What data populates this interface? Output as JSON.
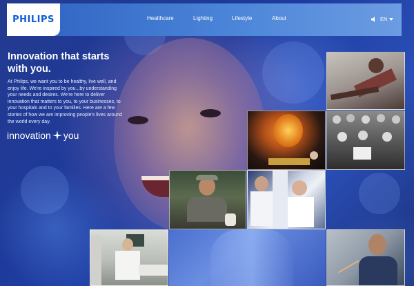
{
  "brand": {
    "logo_text": "PHILIPS"
  },
  "nav": {
    "items": [
      {
        "label": "Healthcare"
      },
      {
        "label": "Lighting"
      },
      {
        "label": "Lifestyle"
      },
      {
        "label": "About"
      }
    ],
    "language": "EN",
    "icons": [
      "speaker-icon",
      "chevron-down-icon"
    ]
  },
  "hero": {
    "headline": "Innovation that starts with you.",
    "body": "At Philips, we want you to be healthy, live well, and enjoy life. We're inspired by you...by understanding your needs and desires. We're here to deliver innovation that matters to you, to your businesses, to your hospitals and to your families. Here are a few stories of how we are improving people's lives around the world every day.",
    "tagline_left": "innovation",
    "tagline_right": "you"
  },
  "colors": {
    "brand_blue": "#0b5ed7",
    "nav_start": "#2d5fbf",
    "nav_end": "#6c9ce2",
    "background": "#1d3a9c"
  }
}
